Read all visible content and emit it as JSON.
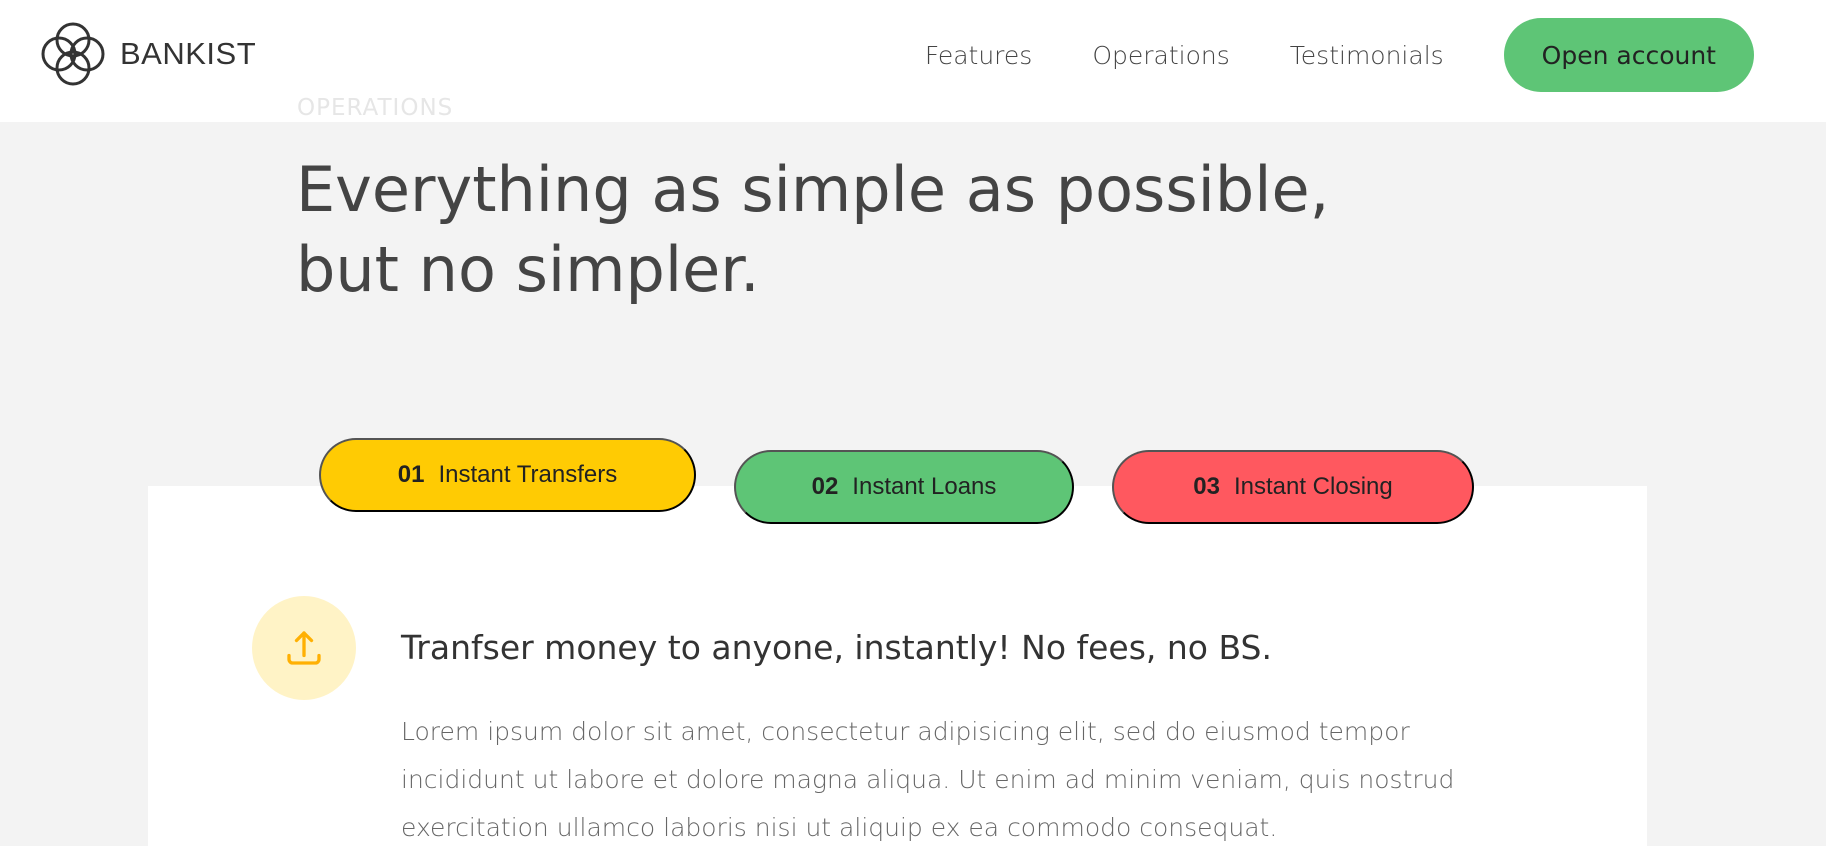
{
  "brand": {
    "name": "BANKIST",
    "logo_icon": "four-circles-logo-icon"
  },
  "nav": {
    "links": [
      "Features",
      "Operations",
      "Testimonials"
    ],
    "cta": "Open account"
  },
  "section": {
    "label": "OPERATIONS",
    "headline": "Everything as simple as possible, but no simpler."
  },
  "tabs": [
    {
      "num": "01",
      "label": "Instant Transfers",
      "color": "#ffcb03",
      "active": true
    },
    {
      "num": "02",
      "label": "Instant Loans",
      "color": "#5ec576",
      "active": false
    },
    {
      "num": "03",
      "label": "Instant Closing",
      "color": "#ff585f",
      "active": false
    }
  ],
  "content": {
    "icon": "upload-icon",
    "title": "Tranfser money to anyone, instantly! No fees, no BS.",
    "text": "Lorem ipsum dolor sit amet, consectetur adipisicing elit, sed do eiusmod tempor incididunt ut labore et dolore magna aliqua. Ut enim ad minim veniam, quis nostrud exercitation ullamco laboris nisi ut aliquip ex ea commodo consequat."
  },
  "colors": {
    "primary": "#5ec576",
    "secondary": "#ffcb03",
    "tertiary": "#ff585f",
    "icon_bg": "#fff3c6",
    "background": "#f3f3f3"
  }
}
